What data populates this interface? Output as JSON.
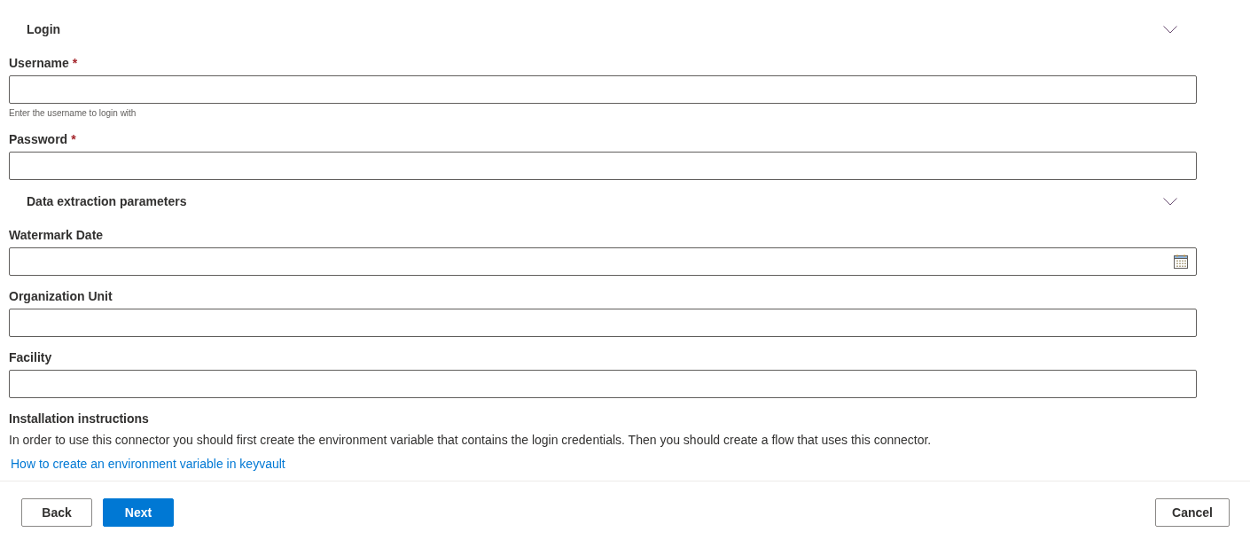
{
  "sections": [
    {
      "title": "Login",
      "expanded": true,
      "fields": [
        {
          "kind": "text",
          "label": "Username",
          "required_mark": "*",
          "hint": "Enter the username to login with"
        },
        {
          "kind": "password",
          "label": "Password",
          "required_mark": "*"
        }
      ]
    },
    {
      "title": "Data extraction parameters",
      "expanded": true,
      "fields": [
        {
          "kind": "date",
          "label": "Watermark Date"
        },
        {
          "kind": "text",
          "label": "Organization Unit"
        },
        {
          "kind": "text",
          "label": "Facility"
        }
      ]
    }
  ],
  "instructions": {
    "title": "Installation instructions",
    "text": "In order to use this connector you should first create the environment variable that contains the login credentials. Then you should create a flow that uses this connector.",
    "link": "How to create an environment variable in keyvault"
  },
  "footer": {
    "left_buttons": [
      {
        "label": "Back",
        "kind": "default"
      },
      {
        "label": "Next",
        "kind": "primary"
      }
    ],
    "right_buttons": [
      {
        "label": "Cancel",
        "kind": "default"
      }
    ]
  }
}
